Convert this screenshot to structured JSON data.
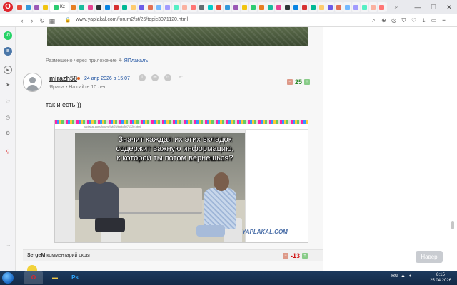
{
  "browser": {
    "active_tab_label": "Kz",
    "url": "www.yaplakal.com/forum2/st/25/topic3071120.html",
    "tab_colors": [
      "#e74c3c",
      "#3498db",
      "#9b59b6",
      "#f1c40f",
      "#2ecc71",
      "#e67e22",
      "#1abc9c",
      "#e84393",
      "#2d3436",
      "#0984e3",
      "#d63031",
      "#00b894",
      "#fdcb6e",
      "#6c5ce7",
      "#e17055",
      "#74b9ff",
      "#a29bfe",
      "#55efc4",
      "#fab1a0",
      "#ff7675",
      "#636e72",
      "#00cec9",
      "#e74c3c",
      "#3498db",
      "#9b59b6",
      "#f1c40f",
      "#2ecc71",
      "#e67e22",
      "#1abc9c",
      "#e84393",
      "#2d3436",
      "#0984e3",
      "#d63031",
      "#00b894",
      "#fdcb6e",
      "#6c5ce7",
      "#e17055",
      "#74b9ff",
      "#a29bfe",
      "#55efc4",
      "#fab1a0",
      "#ff7675",
      "#636e72",
      "#00cec9",
      "#e74c3c",
      "#3498db",
      "#9b59b6",
      "#f1c40f",
      "#2ecc71",
      "#e67e22",
      "#1abc9c",
      "#e84393",
      "#2d3436",
      "#0984e3",
      "#d63031",
      "#00b894",
      "#fdcb6e",
      "#6c5ce7",
      "#e17055",
      "#74b9ff"
    ]
  },
  "post": {
    "via_app_prefix": "Размещено через приложение",
    "via_app_link": "ЯПлакалъ",
    "author": "mirazh58",
    "date": "24 апр 2026 в 15:07",
    "author_status": "Ярила",
    "author_tenure": "На сайте 10 лет",
    "rating": "25",
    "text": "так и есть ))"
  },
  "meme": {
    "caption": "Значит каждая их этих вкладок содержит важную информацию, к которой ты потом вернешься?",
    "watermark": "YAPLAKAL.COM",
    "inner_url": "yaplakal.com/forum2/st/25/topic3071120.html"
  },
  "comment": {
    "user": "SergeM",
    "text": "комментарий скрыт",
    "rating": "-13"
  },
  "next_button": "Навер",
  "taskbar": {
    "tray_lang": "Ru",
    "time": "8:15",
    "date": "25.04.2026"
  }
}
